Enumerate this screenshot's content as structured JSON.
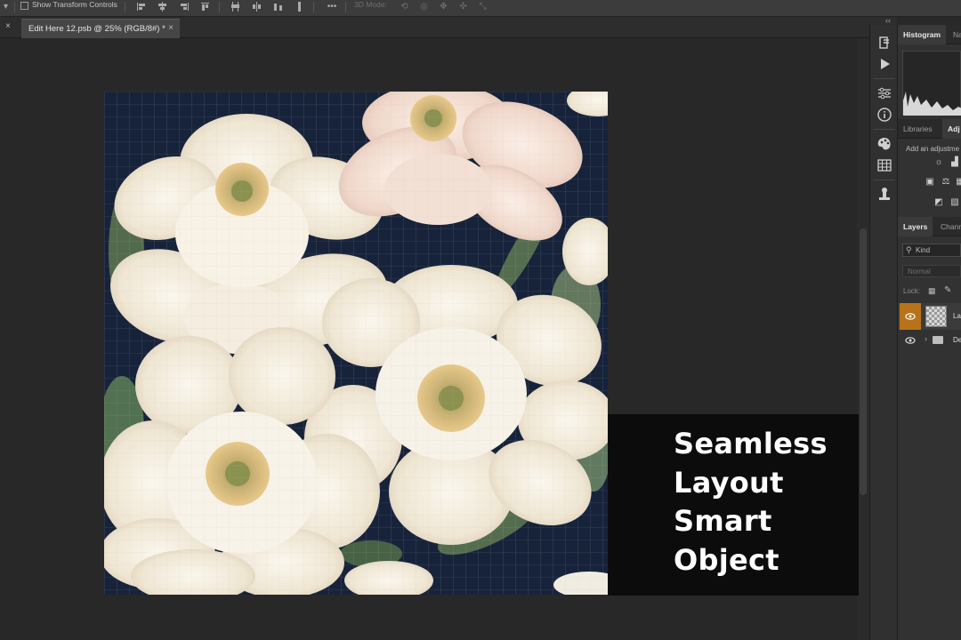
{
  "options_bar": {
    "show_transform_label": "Show Transform Controls",
    "mode_label": "3D Mode:",
    "more_label": "•••"
  },
  "document_tab": {
    "title": "Edit Here 12.psb @ 25% (RGB/8#) *",
    "close_label": "×",
    "left_close_label": "×"
  },
  "panel_collapse_label": "‹‹",
  "tool_strip": {
    "icons": [
      "history-icon",
      "play-icon",
      "adjust-sliders-icon",
      "info-icon",
      "color-palette-icon",
      "swatches-grid-icon",
      "clone-stamp-icon"
    ]
  },
  "histogram_panel": {
    "tabs": [
      "Histogram",
      "Na"
    ]
  },
  "libraries_panel": {
    "tabs": [
      "Libraries",
      "Adj"
    ],
    "hint": "Add an adjustme"
  },
  "layers_panel": {
    "tabs": [
      "Layers",
      "Chann"
    ],
    "filter_label": "Kind",
    "blend_mode": "Normal",
    "lock_label": "Lock:",
    "layers": [
      {
        "name": "La",
        "type": "smart-object"
      },
      {
        "name": "De",
        "type": "group"
      }
    ]
  },
  "caption": {
    "lines": [
      "Seamless",
      "Layout",
      "Smart",
      "Object"
    ]
  },
  "colors": {
    "accent_orange": "#b8731a",
    "panel_bg": "#323232",
    "canvas_bg": "#282828"
  }
}
